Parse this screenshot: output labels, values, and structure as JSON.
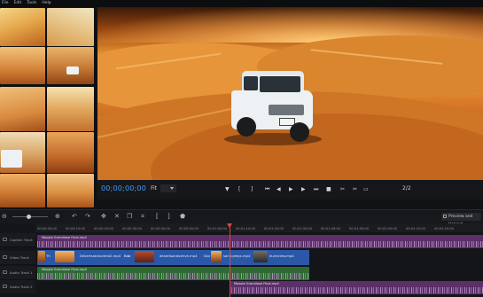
{
  "menu": [
    "File",
    "Edit",
    "Tools",
    "Help"
  ],
  "gallery": {
    "thumbnails": [
      "desert-dunes-1",
      "desert-dunes-2",
      "desert-dunes-3",
      "desert-suv-1",
      "desert-dunes-4",
      "desert-dunes-5",
      "desert-suv-2",
      "desert-dunes-6",
      "desert-dunes-7",
      "desert-dunes-8"
    ]
  },
  "player": {
    "timecode": "00;00;00;00",
    "fit_label": "Fit",
    "page_count": "2/2"
  },
  "toolbar": {
    "preview_button": "Preview and Upload"
  },
  "timeline": {
    "ruler_ticks": [
      "00:00:00:00",
      "00:00:10:00",
      "00:00:20:00",
      "00:00:30:00",
      "00:00:40:00",
      "00:00:50:00",
      "00:01:00:00",
      "00:01:10:00",
      "00:01:20:00",
      "00:01:30:00",
      "00:01:40:00",
      "00:01:50:00",
      "00:02:00:00",
      "00:02:10:00",
      "00:02:20:00"
    ],
    "tracks": [
      {
        "name": "Caption Track"
      },
      {
        "name": "Video Track"
      },
      {
        "name": "Audio Track 1"
      },
      {
        "name": "Audio Track 2"
      }
    ],
    "caption_clip": "Moqzia Grandiose Final.mp4",
    "video_clips": [
      {
        "label": "Th"
      },
      {
        "label": "Desertsandsclimb2.mp4"
      },
      {
        "label": "Bab"
      },
      {
        "label": "desertsandsdrive.mp4"
      },
      {
        "label": "Dsv"
      },
      {
        "label": "sand-jeeps.mp4"
      },
      {
        "label": "duneview.mp4"
      }
    ],
    "audio1_clip": "Moqzia Grandiose Final.mp4",
    "audio2_clip": "Moqzia Grandiose Final.mp4"
  },
  "colors": {
    "timecode": "#3f9bff",
    "audio_clip": "#5b2f68",
    "video_clip": "#2b57a8",
    "playhead": "#e04444"
  }
}
